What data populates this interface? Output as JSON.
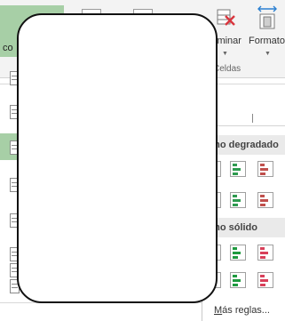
{
  "ribbon": {
    "selected_button": {
      "label": "co",
      "icon": "conditional-format-icon",
      "color": "#a7cfa6"
    },
    "delete_button": {
      "label": "iminar",
      "icon": "delete-cells-icon"
    },
    "format_button": {
      "label": "Formato",
      "icon": "format-cells-icon"
    },
    "group_label": "Celdas"
  },
  "menu": {
    "section_gradient": "eno degradado",
    "section_solid": "eno sólido",
    "more_rules": {
      "first_letter": "M",
      "rest": "ás reglas..."
    },
    "gradient_colors": [
      "#4f81bd",
      "#2e9a4f",
      "#c0504d",
      "#4f81bd",
      "#2e9a4f",
      "#c0504d"
    ],
    "solid_colors": [
      "#1a7ac2",
      "#1f9a3f",
      "#d8405a",
      "#1a7ac2",
      "#1f9a3f",
      "#d8405a"
    ]
  }
}
